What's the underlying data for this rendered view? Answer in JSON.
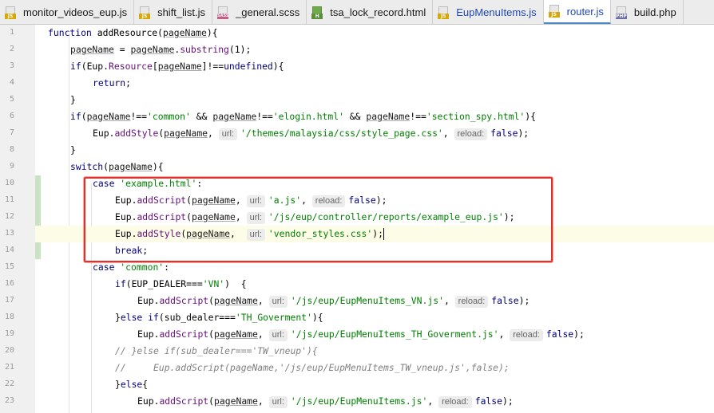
{
  "tabs": [
    {
      "label": "monitor_videos_eup.js",
      "type": "js",
      "badge": "JS",
      "active": false,
      "blue": false
    },
    {
      "label": "shift_list.js",
      "type": "js",
      "badge": "JS",
      "active": false,
      "blue": false
    },
    {
      "label": "_general.scss",
      "type": "sass",
      "badge": "SASS",
      "active": false,
      "blue": false
    },
    {
      "label": "tsa_lock_record.html",
      "type": "html",
      "badge": "H",
      "active": false,
      "blue": false
    },
    {
      "label": "EupMenuItems.js",
      "type": "js",
      "badge": "JS",
      "active": false,
      "blue": true
    },
    {
      "label": "router.js",
      "type": "js",
      "badge": "JS",
      "active": true,
      "blue": true
    },
    {
      "label": "build.php",
      "type": "php",
      "badge": "PHP",
      "active": false,
      "blue": false
    }
  ],
  "editor": {
    "current_line": 13,
    "highlight_colors": {
      "box": "#e2302d",
      "vcs_added": "#c9e3c4"
    },
    "lines": [
      {
        "n": "1",
        "indent": 0,
        "tokens": [
          [
            "kw",
            "function "
          ],
          [
            "fn",
            "addResource"
          ],
          [
            "",
            "("
          ],
          [
            "var",
            "pageName"
          ],
          [
            "",
            "){"
          ]
        ]
      },
      {
        "n": "2",
        "indent": 1,
        "tokens": [
          [
            "var",
            "pageName"
          ],
          [
            "",
            " = "
          ],
          [
            "var",
            "pageName"
          ],
          [
            "",
            "."
          ],
          [
            "prop",
            "substring"
          ],
          [
            "",
            "(1);"
          ]
        ]
      },
      {
        "n": "3",
        "indent": 1,
        "tokens": [
          [
            "kw",
            "if"
          ],
          [
            "",
            "(Eup."
          ],
          [
            "prop",
            "Resource"
          ],
          [
            "",
            "["
          ],
          [
            "var",
            "pageName"
          ],
          [
            "",
            "]!=="
          ],
          [
            "kw",
            "undefined"
          ],
          [
            "",
            "){"
          ]
        ]
      },
      {
        "n": "4",
        "indent": 2,
        "tokens": [
          [
            "kw",
            "return"
          ],
          [
            "",
            ";"
          ]
        ]
      },
      {
        "n": "5",
        "indent": 1,
        "tokens": [
          [
            "",
            "}"
          ]
        ]
      },
      {
        "n": "6",
        "indent": 1,
        "tokens": [
          [
            "kw",
            "if"
          ],
          [
            "",
            "("
          ],
          [
            "var",
            "pageName"
          ],
          [
            "",
            "!=="
          ],
          [
            "str",
            "'common'"
          ],
          [
            "",
            " && "
          ],
          [
            "var",
            "pageName"
          ],
          [
            "",
            "!=="
          ],
          [
            "str",
            "'elogin.html'"
          ],
          [
            "",
            " && "
          ],
          [
            "var",
            "pageName"
          ],
          [
            "",
            "!=="
          ],
          [
            "str",
            "'section_spy.html'"
          ],
          [
            "",
            "){"
          ]
        ]
      },
      {
        "n": "7",
        "indent": 2,
        "tokens": [
          [
            "",
            "Eup."
          ],
          [
            "prop",
            "addStyle"
          ],
          [
            "",
            "("
          ],
          [
            "var",
            "pageName"
          ],
          [
            "",
            ", "
          ],
          [
            "hint",
            "url:"
          ],
          [
            "str",
            "'/themes/malaysia/css/style_page.css'"
          ],
          [
            "",
            ", "
          ],
          [
            "hint",
            "reload:"
          ],
          [
            "kw",
            "false"
          ],
          [
            "",
            ");"
          ]
        ]
      },
      {
        "n": "8",
        "indent": 1,
        "tokens": [
          [
            "",
            "}"
          ]
        ]
      },
      {
        "n": "9",
        "indent": 1,
        "tokens": [
          [
            "kw",
            "switch"
          ],
          [
            "",
            "("
          ],
          [
            "var",
            "pageName"
          ],
          [
            "",
            "){"
          ]
        ]
      },
      {
        "n": "10",
        "indent": 2,
        "tokens": [
          [
            "kw",
            "case "
          ],
          [
            "str",
            "'example.html'"
          ],
          [
            "",
            ":"
          ]
        ]
      },
      {
        "n": "11",
        "indent": 3,
        "tokens": [
          [
            "",
            "Eup."
          ],
          [
            "prop",
            "addScript"
          ],
          [
            "",
            "("
          ],
          [
            "var",
            "pageName"
          ],
          [
            "",
            ", "
          ],
          [
            "hint",
            "url:"
          ],
          [
            "str",
            "'a.js'"
          ],
          [
            "",
            ", "
          ],
          [
            "hint",
            "reload:"
          ],
          [
            "kw",
            "false"
          ],
          [
            "",
            ");"
          ]
        ]
      },
      {
        "n": "12",
        "indent": 3,
        "tokens": [
          [
            "",
            "Eup."
          ],
          [
            "prop",
            "addScript"
          ],
          [
            "",
            "("
          ],
          [
            "var",
            "pageName"
          ],
          [
            "",
            ", "
          ],
          [
            "hint",
            "url:"
          ],
          [
            "str",
            "'/js/eup/controller/reports/example_eup.js'"
          ],
          [
            "",
            ");"
          ]
        ]
      },
      {
        "n": "13",
        "indent": 3,
        "tokens": [
          [
            "",
            "Eup."
          ],
          [
            "prop",
            "addStyle"
          ],
          [
            "",
            "("
          ],
          [
            "var",
            "pageName"
          ],
          [
            "",
            ",  "
          ],
          [
            "hint",
            "url:"
          ],
          [
            "str",
            "'vendor_styles.css'"
          ],
          [
            "",
            ");"
          ],
          [
            "caret",
            ""
          ]
        ]
      },
      {
        "n": "14",
        "indent": 3,
        "tokens": [
          [
            "kw",
            "break"
          ],
          [
            "",
            ";"
          ]
        ]
      },
      {
        "n": "15",
        "indent": 2,
        "tokens": [
          [
            "kw",
            "case "
          ],
          [
            "str",
            "'common'"
          ],
          [
            "",
            ":"
          ]
        ]
      },
      {
        "n": "16",
        "indent": 3,
        "tokens": [
          [
            "kw",
            "if"
          ],
          [
            "",
            "(EUP_DEALER==="
          ],
          [
            "str",
            "'VN'"
          ],
          [
            "",
            ")  {"
          ]
        ]
      },
      {
        "n": "17",
        "indent": 4,
        "tokens": [
          [
            "",
            "Eup."
          ],
          [
            "prop",
            "addScript"
          ],
          [
            "",
            "("
          ],
          [
            "var",
            "pageName"
          ],
          [
            "",
            ", "
          ],
          [
            "hint",
            "url:"
          ],
          [
            "str",
            "'/js/eup/EupMenuItems_VN.js'"
          ],
          [
            "",
            ", "
          ],
          [
            "hint",
            "reload:"
          ],
          [
            "kw",
            "false"
          ],
          [
            "",
            ");"
          ]
        ]
      },
      {
        "n": "18",
        "indent": 3,
        "tokens": [
          [
            "",
            "}"
          ],
          [
            "kw",
            "else if"
          ],
          [
            "",
            "(sub_dealer==="
          ],
          [
            "str",
            "'TH_Goverment'"
          ],
          [
            "",
            "){"
          ]
        ]
      },
      {
        "n": "19",
        "indent": 4,
        "tokens": [
          [
            "",
            "Eup."
          ],
          [
            "prop",
            "addScript"
          ],
          [
            "",
            "("
          ],
          [
            "var",
            "pageName"
          ],
          [
            "",
            ", "
          ],
          [
            "hint",
            "url:"
          ],
          [
            "str",
            "'/js/eup/EupMenuItems_TH_Goverment.js'"
          ],
          [
            "",
            ", "
          ],
          [
            "hint",
            "reload:"
          ],
          [
            "kw",
            "false"
          ],
          [
            "",
            ");"
          ]
        ]
      },
      {
        "n": "20",
        "indent": 3,
        "tokens": [
          [
            "cmt",
            "// }else if(sub_dealer==='TW_vneup'){"
          ]
        ]
      },
      {
        "n": "21",
        "indent": 3,
        "tokens": [
          [
            "cmt",
            "//     Eup.addScript(pageName,'/js/eup/EupMenuItems_TW_vneup.js',false);"
          ]
        ]
      },
      {
        "n": "22",
        "indent": 3,
        "tokens": [
          [
            "",
            "}"
          ],
          [
            "kw",
            "else"
          ],
          [
            "",
            "{"
          ]
        ]
      },
      {
        "n": "23",
        "indent": 4,
        "tokens": [
          [
            "",
            "Eup."
          ],
          [
            "prop",
            "addScript"
          ],
          [
            "",
            "("
          ],
          [
            "var",
            "pageName"
          ],
          [
            "",
            ", "
          ],
          [
            "hint",
            "url:"
          ],
          [
            "str",
            "'/js/eup/EupMenuItems.js'"
          ],
          [
            "",
            ", "
          ],
          [
            "hint",
            "reload:"
          ],
          [
            "kw",
            "false"
          ],
          [
            "",
            ");"
          ]
        ]
      }
    ]
  }
}
